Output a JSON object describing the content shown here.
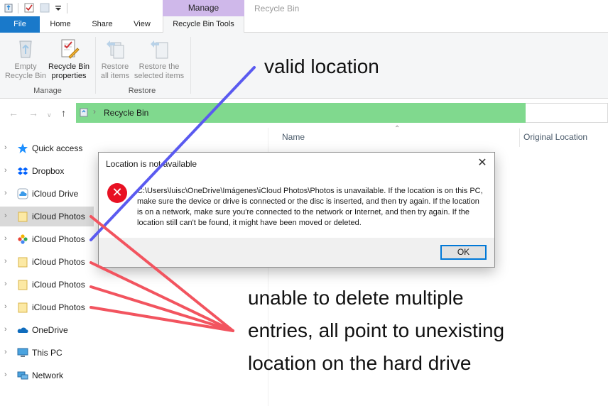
{
  "titlebar": {
    "manage_label": "Manage",
    "window_title": "Recycle Bin"
  },
  "tabs": {
    "file": "File",
    "home": "Home",
    "share": "Share",
    "view": "View",
    "recycle_bin_tools": "Recycle Bin Tools"
  },
  "ribbon": {
    "empty_line1": "Empty",
    "empty_line2": "Recycle Bin",
    "props_line1": "Recycle Bin",
    "props_line2": "properties",
    "restore_all_line1": "Restore",
    "restore_all_line2": "all items",
    "restore_sel_line1": "Restore the",
    "restore_sel_line2": "selected items",
    "group_manage": "Manage",
    "group_restore": "Restore"
  },
  "address": {
    "location": "Recycle Bin"
  },
  "nav": [
    {
      "label": "Quick access",
      "icon": "star-icon"
    },
    {
      "label": "Dropbox",
      "icon": "dropbox-icon"
    },
    {
      "label": "iCloud Drive",
      "icon": "icloud-icon"
    },
    {
      "label": "iCloud Photos",
      "icon": "folder-icon"
    },
    {
      "label": "iCloud Photos",
      "icon": "photos-icon"
    },
    {
      "label": "iCloud Photos",
      "icon": "folder-icon"
    },
    {
      "label": "iCloud Photos",
      "icon": "folder-icon"
    },
    {
      "label": "iCloud Photos",
      "icon": "folder-icon"
    },
    {
      "label": "OneDrive",
      "icon": "onedrive-icon"
    },
    {
      "label": "This PC",
      "icon": "pc-icon"
    },
    {
      "label": "Network",
      "icon": "network-icon"
    }
  ],
  "columns": {
    "name": "Name",
    "original_location": "Original Location"
  },
  "dialog": {
    "title": "Location is not available",
    "message": "C:\\Users\\luisc\\OneDrive\\Imágenes\\iCloud Photos\\Photos is unavailable. If the location is on this PC, make sure the device or drive is connected or the disc is inserted, and then try again. If the location is on a network, make sure you're connected to the network or Internet, and then try again. If the location still can't be found, it might have been moved or deleted.",
    "ok": "OK"
  },
  "annotations": {
    "valid": "valid location",
    "unable_line1": "unable to delete multiple",
    "unable_line2": "entries, all point to unexisting",
    "unable_line3": "location on the hard drive",
    "blue_line_color": "#5a5af0",
    "red_line_color": "#f2545f"
  },
  "colors": {
    "address_highlight": "#80d98e",
    "file_tab": "#1979ca",
    "manage_tab": "#cfb8ea",
    "error_red": "#e81123"
  }
}
